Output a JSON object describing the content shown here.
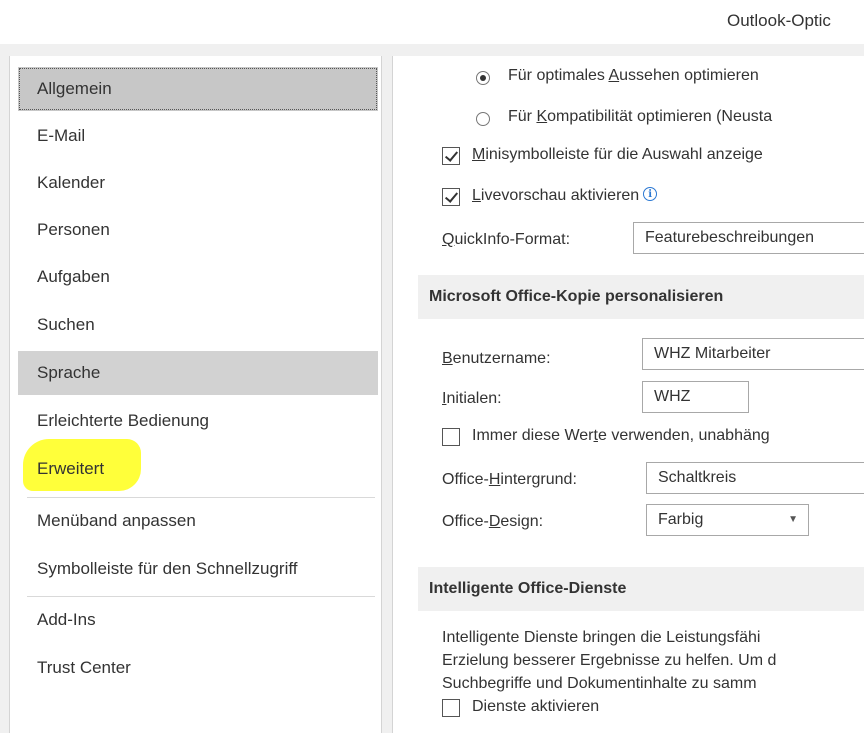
{
  "window": {
    "title": "Outlook-Optic"
  },
  "sidebar": {
    "items": [
      {
        "label": "Allgemein"
      },
      {
        "label": "E-Mail"
      },
      {
        "label": "Kalender"
      },
      {
        "label": "Personen"
      },
      {
        "label": "Aufgaben"
      },
      {
        "label": "Suchen"
      },
      {
        "label": "Sprache"
      },
      {
        "label": "Erleichterte Bedienung"
      },
      {
        "label": "Erweitert"
      },
      {
        "label": "Menüband anpassen"
      },
      {
        "label": "Symbolleiste für den Schnellzugriff"
      },
      {
        "label": "Add-Ins"
      },
      {
        "label": "Trust Center"
      }
    ],
    "highlight_color": "#ffff3a"
  },
  "ui_options": {
    "radio_optimal": {
      "pre": "Für optimales ",
      "accel": "A",
      "post": "ussehen optimieren",
      "checked": true
    },
    "radio_compat": {
      "pre": "Für ",
      "accel": "K",
      "post": "ompatibilität optimieren (Neusta",
      "checked": false
    },
    "mini_toolbar": {
      "accel": "M",
      "post": "inisymbolleiste für die Auswahl anzeige",
      "checked": true
    },
    "live_preview": {
      "accel": "L",
      "post": "ivevorschau aktivieren",
      "checked": true
    },
    "info_icon": "i",
    "quickinfo": {
      "accel": "Q",
      "post": "uickInfo-Format:",
      "value": "Featurebeschreibungen"
    }
  },
  "personalize": {
    "header": "Microsoft Office-Kopie personalisieren",
    "username": {
      "accel": "B",
      "post": "enutzername:",
      "value": "WHZ Mitarbeiter"
    },
    "initials": {
      "accel": "I",
      "post": "nitialen:",
      "value": "WHZ"
    },
    "always_use": {
      "pre": "Immer diese Wer",
      "accel": "t",
      "post": "e verwenden, unabhäng",
      "checked": false
    },
    "background": {
      "pre": "Office-",
      "accel": "H",
      "post": "intergrund:",
      "value": "Schaltkreis"
    },
    "design": {
      "pre": "Office-",
      "accel": "D",
      "post": "esign:",
      "value": "Farbig"
    }
  },
  "intelligent": {
    "header": "Intelligente Office-Dienste",
    "lines": [
      "Intelligente Dienste bringen die Leistungsfähi",
      "Erzielung besserer Ergebnisse zu helfen. Um d",
      "Suchbegriffe und Dokumentinhalte zu samm"
    ],
    "enable": {
      "label": "Dienste aktivieren",
      "checked": false
    }
  }
}
